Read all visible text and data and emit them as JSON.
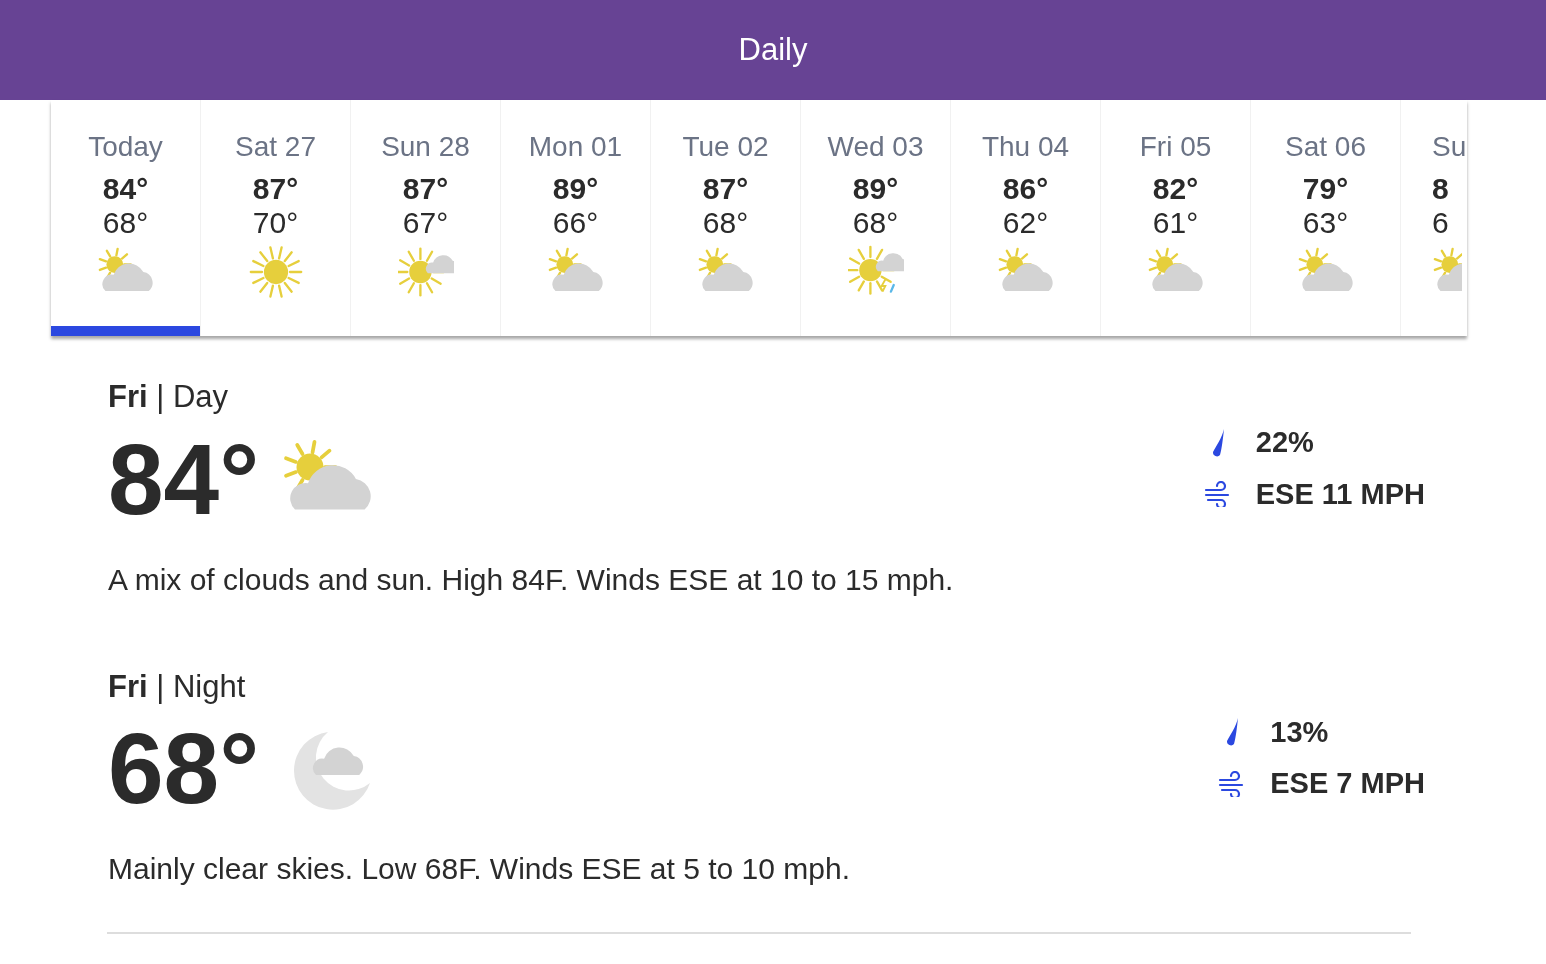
{
  "header": {
    "title": "Daily"
  },
  "days": [
    {
      "label": "Today",
      "high": "84°",
      "low": "68°",
      "kind": "partly_cloudy",
      "selected": true
    },
    {
      "label": "Sat 27",
      "high": "87°",
      "low": "70°",
      "kind": "sunny",
      "selected": false
    },
    {
      "label": "Sun 28",
      "high": "87°",
      "low": "67°",
      "kind": "mostly_sunny",
      "selected": false
    },
    {
      "label": "Mon 01",
      "high": "89°",
      "low": "66°",
      "kind": "partly_cloudy",
      "selected": false
    },
    {
      "label": "Tue 02",
      "high": "87°",
      "low": "68°",
      "kind": "partly_cloudy",
      "selected": false
    },
    {
      "label": "Wed 03",
      "high": "89°",
      "low": "68°",
      "kind": "thunder",
      "selected": false
    },
    {
      "label": "Thu 04",
      "high": "86°",
      "low": "62°",
      "kind": "partly_cloudy",
      "selected": false
    },
    {
      "label": "Fri 05",
      "high": "82°",
      "low": "61°",
      "kind": "partly_cloudy",
      "selected": false
    },
    {
      "label": "Sat 06",
      "high": "79°",
      "low": "63°",
      "kind": "partly_cloudy",
      "selected": false
    },
    {
      "label": "Su",
      "high": "8",
      "low": "6",
      "kind": "partly_cloudy",
      "selected": false,
      "cut": true
    }
  ],
  "periods": [
    {
      "title": "**Fri** | Day",
      "temp": "84°",
      "kind": "partly_cloudy",
      "precip": "22%",
      "wind": "ESE 11 MPH",
      "description": "A mix of clouds and sun. High 84F. Winds ESE at 10 to 15 mph."
    },
    {
      "title": "**Fri** | Night",
      "temp": "68°",
      "kind": "night",
      "precip": "13%",
      "wind": "ESE 7 MPH",
      "description": "Mainly clear skies. Low 68F. Winds ESE at 5 to 10 mph."
    }
  ]
}
